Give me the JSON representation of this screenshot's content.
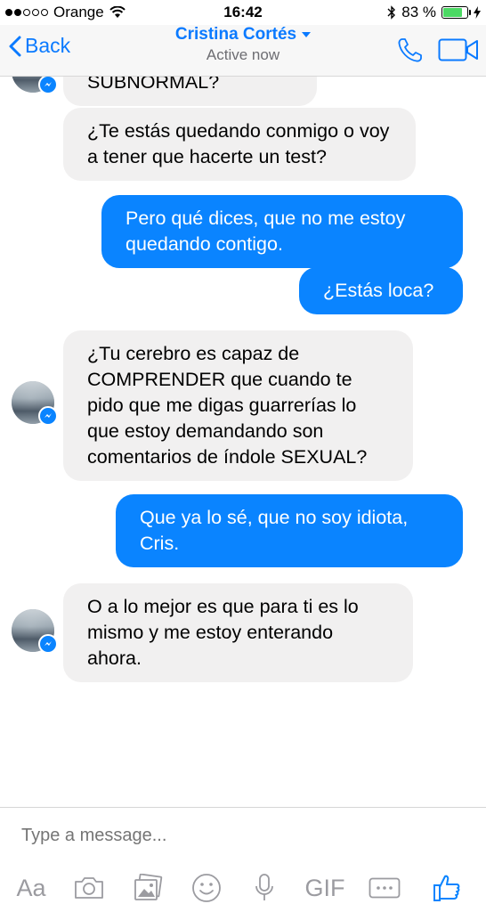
{
  "status_bar": {
    "carrier": "Orange",
    "time": "16:42",
    "battery": "83 %"
  },
  "nav": {
    "back_label": "Back",
    "contact_name": "Cristina Cortés",
    "contact_status": "Active now"
  },
  "messages": [
    {
      "from": "in",
      "text": "SUBNORMAL?"
    },
    {
      "from": "in",
      "text": "¿Te estás quedando conmigo o voy a tener que hacerte un test?"
    },
    {
      "from": "out",
      "text": "Pero qué dices, que no me estoy quedando contigo."
    },
    {
      "from": "out",
      "text": "¿Estás loca?"
    },
    {
      "from": "in",
      "text": "¿Tu cerebro es capaz de COMPRENDER que cuando te pido que me digas guarrerías lo que estoy demandando son comentarios de índole SEXUAL?"
    },
    {
      "from": "out",
      "text": "Que ya lo sé, que no soy idiota, Cris."
    },
    {
      "from": "in",
      "text": "O a lo mejor es que para ti es lo mismo y me estoy enterando ahora."
    }
  ],
  "composer": {
    "placeholder": "Type a message...",
    "tools": {
      "text": "Aa",
      "camera": "camera-icon",
      "gallery": "gallery-icon",
      "emoji": "emoji-icon",
      "mic": "mic-icon",
      "gif": "GIF",
      "more": "more-icon",
      "like": "thumbs-up-icon"
    }
  },
  "colors": {
    "accent": "#0a7aff",
    "outgoing": "#0a84ff",
    "incoming": "#f1f0f0",
    "battery": "#4cd964"
  }
}
